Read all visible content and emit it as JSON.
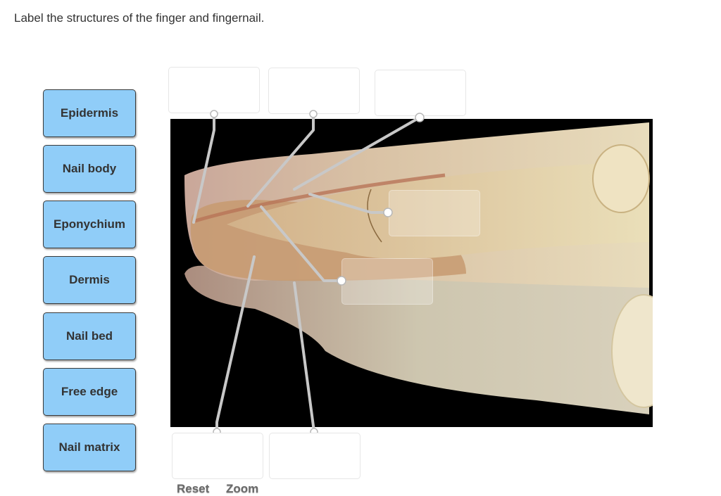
{
  "prompt": "Label the structures of the finger and fingernail.",
  "labels": [
    {
      "text": "Epidermis"
    },
    {
      "text": "Nail body"
    },
    {
      "text": "Eponychium"
    },
    {
      "text": "Dermis"
    },
    {
      "text": "Nail bed"
    },
    {
      "text": "Free edge"
    },
    {
      "text": "Nail matrix"
    }
  ],
  "drop_targets": [
    {
      "id": "top-1",
      "value": ""
    },
    {
      "id": "top-2",
      "value": ""
    },
    {
      "id": "top-3",
      "value": ""
    },
    {
      "id": "inner-right",
      "value": ""
    },
    {
      "id": "inner-lower",
      "value": ""
    },
    {
      "id": "bottom-1",
      "value": ""
    },
    {
      "id": "bottom-2",
      "value": ""
    }
  ],
  "image": {
    "alt": "Sagittal section of fingertip and fingernail"
  },
  "controls": {
    "reset": "Reset",
    "zoom": "Zoom"
  },
  "colors": {
    "label_fill": "#90cdf8",
    "leader": "#c8c8c8"
  }
}
